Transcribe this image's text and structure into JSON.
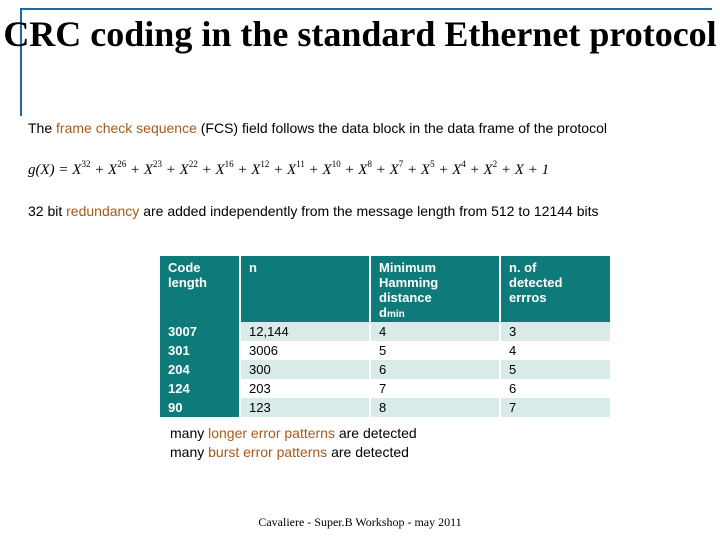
{
  "title": "CRC coding in the standard Ethernet protocol",
  "intro": {
    "prefix": "The ",
    "fcs": "frame check sequence",
    "rest": " (FCS) field follows the data block in the data frame of the protocol"
  },
  "polynomial": {
    "lhs": "g(X) = X",
    "terms": [
      "32",
      "26",
      "23",
      "22",
      "16",
      "12",
      "11",
      "10",
      "8",
      "7",
      "5",
      "4",
      "2"
    ],
    "tail": " + X + 1"
  },
  "redundancy": {
    "prefix": "32 bit ",
    "red": "redundancy",
    "rest": " are added independently from the message length from 512 to 12144 bits"
  },
  "table": {
    "headers": {
      "c1": "Code length",
      "c2": "n",
      "c3_line1": "Minimum",
      "c3_line2": "Hamming",
      "c3_line3": "distance",
      "c3_line4": "d",
      "c3_sub": "min",
      "c4_line1": "n. of",
      "c4_line2": "detected",
      "c4_line3": "errros"
    },
    "rows": [
      {
        "c1": "3007",
        "c2": "12,144",
        "c3": "4",
        "c4": "3"
      },
      {
        "c1": "301",
        "c2": "3006",
        "c3": "5",
        "c4": "4"
      },
      {
        "c1": "204",
        "c2": "300",
        "c3": "6",
        "c4": "5"
      },
      {
        "c1": "124",
        "c2": "203",
        "c3": "7",
        "c4": "6"
      },
      {
        "c1": "90",
        "c2": "123",
        "c3": "8",
        "c4": "7"
      }
    ]
  },
  "notes": {
    "l1_a": "many ",
    "l1_b": "longer error patterns",
    "l1_c": " are detected",
    "l2_a": "many ",
    "l2_b": "burst error patterns",
    "l2_c": " are detected"
  },
  "footer": "Cavaliere - Super.B Workshop - may 2011",
  "chart_data": {
    "type": "table",
    "title": "CRC-32 minimum Hamming distance vs code length",
    "columns": [
      "Code length",
      "n",
      "Minimum Hamming distance d_min",
      "n. of detected errors"
    ],
    "rows": [
      [
        3007,
        12144,
        4,
        3
      ],
      [
        301,
        3006,
        5,
        4
      ],
      [
        204,
        300,
        6,
        5
      ],
      [
        124,
        203,
        7,
        6
      ],
      [
        90,
        123,
        8,
        7
      ]
    ]
  }
}
